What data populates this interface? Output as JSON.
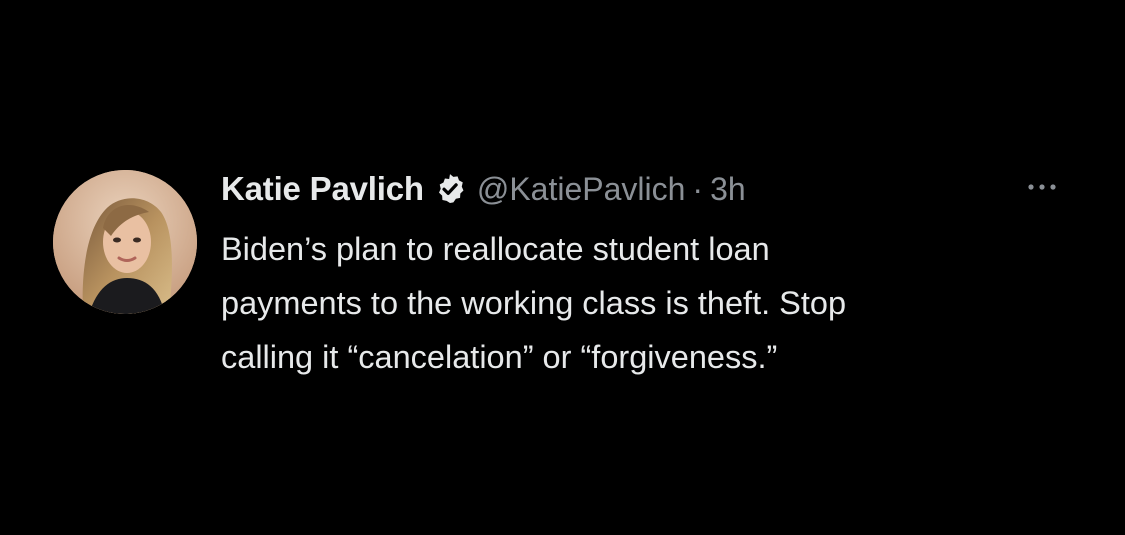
{
  "tweet": {
    "author": {
      "display_name": "Katie Pavlich",
      "handle": "@KatiePavlich",
      "verified_icon": "verified-badge-icon",
      "avatar": "profile-photo"
    },
    "separator": "·",
    "time": "3h",
    "more_icon": "more-options-icon",
    "text_lines": [
      "Biden’s plan to reallocate student loan",
      "payments to the working class is theft. Stop",
      "calling it “cancelation” or “forgiveness.”"
    ]
  },
  "colors": {
    "background": "#000000",
    "primary_text": "#e7e9ea",
    "secondary_text": "#8b9096"
  }
}
